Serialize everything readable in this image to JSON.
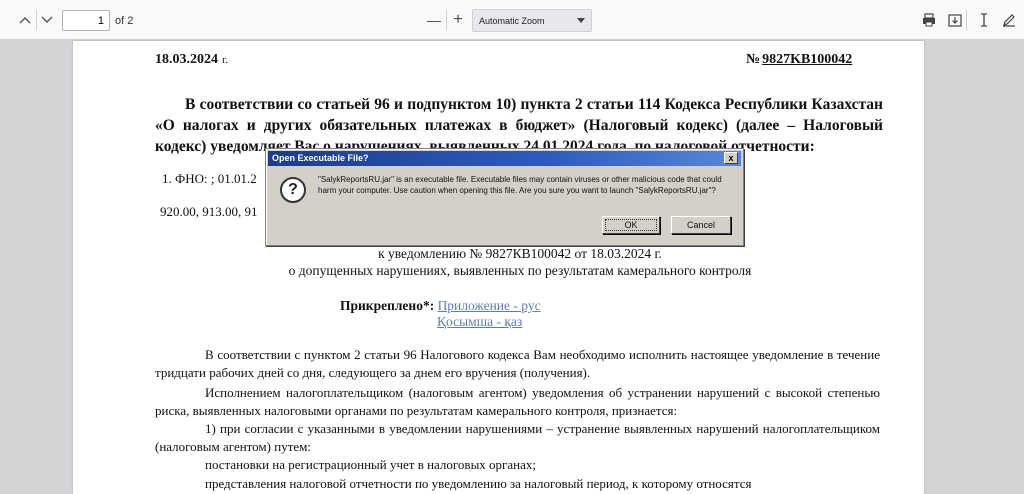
{
  "toolbar": {
    "page_current": "1",
    "page_count": "of 2",
    "zoom": "Automatic Zoom",
    "zoom_out": "—",
    "zoom_in": "+"
  },
  "document": {
    "date": "18.03.2024",
    "date_suffix": "г.",
    "number_prefix": "№",
    "number": "9827KB100042",
    "intro": "В соответствии со статьей 96 и подпунктом 10) пункта 2 статьи 114 Кодекса Республики Казахстан «О налогах и других обязательных платежах в бюджет» (Налоговый кодекс) (далее – Налоговый кодекс) уведомляет Вас о нарушениях, выявленных 24.01.2024 года, по налоговой отчетности:",
    "fno_line": "1. ФНО: ; 01.01.2",
    "codes_line": "920.00, 913.00, 91",
    "notice_line": "к уведомлению № 9827КВ100042 от 18.03.2024 г.",
    "violations_line": "о допущенных нарушениях, выявленных по результатам камерального контроля",
    "attached_label": "Прикреплено*:",
    "attach_ru": "Приложение - рус",
    "attach_kz": "Қосымша - қаз",
    "para1": "В соответствии с пунктом 2 статьи 96 Налогового кодекса Вам необходимо исполнить настоящее уведомление в течение тридцати рабочих дней со дня, следующего за днем его вручения (получения).",
    "para2": "Исполнением налогоплательщиком (налоговым агентом) уведомления об устранении нарушений с высокой степенью риска, выявленных налоговыми органами по результатам камерального контроля, признается:",
    "para3": "1) при согласии с указанными в уведомлении нарушениями – устранение выявленных нарушений налогоплательщиком (налоговым агентом) путем:",
    "para4": "постановки на регистрационный учет в налоговых органах;",
    "para5": "представления налоговой отчетности по уведомлению за налоговый период, к которому относятся"
  },
  "dialog": {
    "title": "Open Executable File?",
    "close": "x",
    "icon": "?",
    "message": "\"SalykReportsRU.jar\" is an executable file. Executable files may contain viruses or other malicious code that could harm your computer. Use caution when opening this file. Are you sure you want to launch \"SalykReportsRU.jar\"?",
    "ok": "OK",
    "cancel": "Cancel"
  },
  "colors": {
    "title_bar": "#1c3c8a",
    "link": "#5b7fb3",
    "dialog_bg": "#d4d0c8"
  }
}
